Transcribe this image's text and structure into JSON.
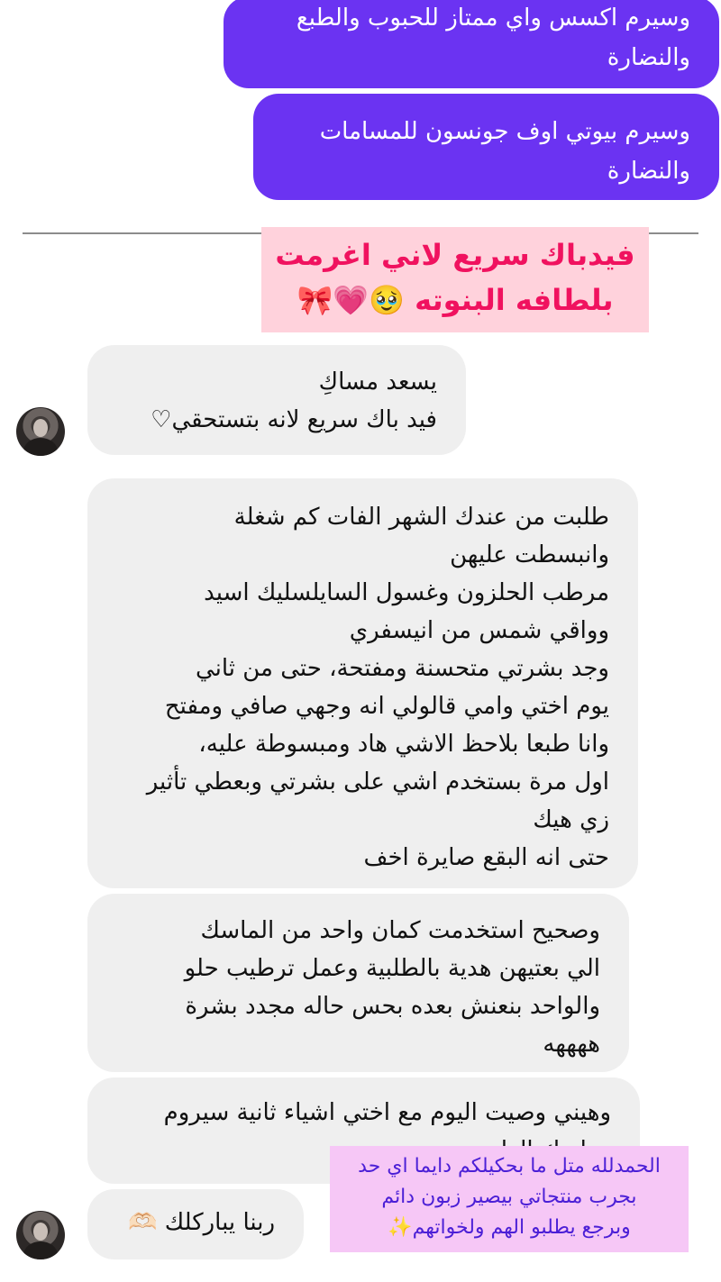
{
  "sent_messages": [
    {
      "lines": [
        "وسيرم اكسس واي ممتاز للحبوب والطبع",
        "والنضارة"
      ]
    },
    {
      "lines": [
        "وسيرم بيوتي اوف جونسون للمسامات",
        "والنضارة"
      ]
    }
  ],
  "headline": {
    "lines": [
      "فيدباك سريع لاني اغرمت",
      "بلطافه البنوته 🥹💗🎀"
    ]
  },
  "received_messages": [
    {
      "lines": [
        "يسعد مساكِ",
        "فيد باك سريع لانه بتستحقي♡"
      ]
    },
    {
      "lines": [
        "طلبت من عندك الشهر الفات كم شغلة",
        "وانبسطت عليهن",
        "مرطب الحلزون وغسول السايلسليك اسيد",
        "وواقي شمس من انيسفري",
        "وجد بشرتي متحسنة ومفتحة، حتى من ثاني",
        "يوم اختي وامي قالولي انه وجهي صافي ومفتح",
        "وانا طبعا بلاحظ الاشي هاد ومبسوطة عليه،",
        "اول مرة بستخدم اشي على بشرتي وبعطي تأثير",
        "زي هيك",
        "حتى انه البقع صايرة اخف"
      ]
    },
    {
      "lines": [
        "وصحيح استخدمت كمان واحد من الماسك",
        "الي بعتيهن هدية بالطلبية وعمل ترطيب حلو",
        "والواحد بنعنش بعده بحس حاله مجدد بشرة",
        "ههههه"
      ]
    },
    {
      "lines": [
        "وهيني وصيت اليوم مع اختي اشياء ثانية سيروم",
        "وماسك الطين"
      ]
    },
    {
      "lines": [
        "ربنا يباركلك 🫶🏻"
      ]
    }
  ],
  "overlay_note": {
    "lines": [
      "الحمدلله متل ما بحكيلكم دايما اي حد",
      "بجرب منتجاتي بيصير زبون دائم",
      "وبرجع يطلبو الهم ولخواتهم✨"
    ]
  },
  "colors": {
    "sent_bubble": "#6b33f2",
    "received_bubble": "#efefef",
    "headline_bg": "#ffd2dc",
    "headline_text": "#f0125f",
    "note_bg": "#f6c7f6",
    "note_text": "#4b1fd6"
  }
}
